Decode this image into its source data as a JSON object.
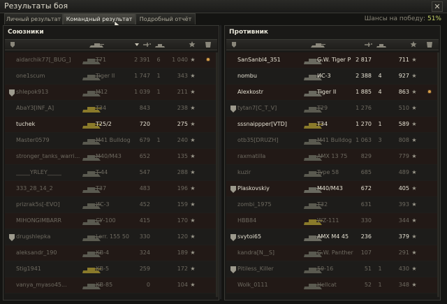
{
  "window": {
    "title": "Результаты боя",
    "close_label": "✕"
  },
  "tabs": [
    {
      "label": "Личный результат",
      "active": false
    },
    {
      "label": "Командный результат",
      "active": true
    },
    {
      "label": "Подробный отчёт",
      "active": false
    }
  ],
  "win_chance": {
    "label": "Шансы на победу:",
    "value": "51%"
  },
  "allies": {
    "title": "Союзники",
    "rows": [
      {
        "name": "aidarchik77[_BUG_]",
        "vehicle": "T71",
        "damage": "2 391",
        "kills": "6",
        "xp": "1 040",
        "status": "dead",
        "medal": true,
        "platoon": false,
        "tank_color": "#5a5a50"
      },
      {
        "name": "one1scum",
        "vehicle": "Tiger II",
        "damage": "1 747",
        "kills": "1",
        "xp": "343",
        "status": "dead",
        "medal": false,
        "platoon": false,
        "tank_color": "#5a5a50"
      },
      {
        "name": "shlepok913",
        "vehicle": "M12",
        "damage": "1 039",
        "kills": "1",
        "xp": "211",
        "status": "dead",
        "medal": false,
        "platoon": true,
        "tank_color": "#5a5a50"
      },
      {
        "name": "AbaY3[INF_A]",
        "vehicle": "T34",
        "damage": "843",
        "kills": "",
        "xp": "238",
        "status": "dead",
        "medal": false,
        "platoon": false,
        "tank_color": "#8a7a2a"
      },
      {
        "name": "tuchek",
        "vehicle": "T25/2",
        "damage": "720",
        "kills": "",
        "xp": "275",
        "status": "alive",
        "medal": false,
        "platoon": false,
        "tank_color": "#8a7a2a"
      },
      {
        "name": "Master0579",
        "vehicle": "M41 Bulldog",
        "damage": "679",
        "kills": "1",
        "xp": "240",
        "status": "dead",
        "medal": false,
        "platoon": false,
        "tank_color": "#5a5a50"
      },
      {
        "name": "stronger_tanks_warri...",
        "vehicle": "M40/M43",
        "damage": "652",
        "kills": "",
        "xp": "135",
        "status": "dead",
        "medal": false,
        "platoon": false,
        "tank_color": "#5a5a50"
      },
      {
        "name": "_____YRLEY_____",
        "vehicle": "T-44",
        "damage": "547",
        "kills": "",
        "xp": "288",
        "status": "dead",
        "medal": false,
        "platoon": false,
        "tank_color": "#5a5a50"
      },
      {
        "name": "333_28_14_2",
        "vehicle": "T37",
        "damage": "483",
        "kills": "",
        "xp": "196",
        "status": "dead",
        "medal": false,
        "platoon": false,
        "tank_color": "#5a5a50"
      },
      {
        "name": "prizrak5s[-EVO]",
        "vehicle": "ИС-3",
        "damage": "452",
        "kills": "",
        "xp": "159",
        "status": "dead",
        "medal": false,
        "platoon": false,
        "tank_color": "#5a5a50"
      },
      {
        "name": "MIHONGIMBARR",
        "vehicle": "СУ-100",
        "damage": "415",
        "kills": "",
        "xp": "170",
        "status": "dead",
        "medal": false,
        "platoon": false,
        "tank_color": "#5a5a50"
      },
      {
        "name": "drugshlepka",
        "vehicle": "Lorr. 155 50",
        "damage": "330",
        "kills": "",
        "xp": "120",
        "status": "dead",
        "medal": false,
        "platoon": true,
        "tank_color": "#5a5a50"
      },
      {
        "name": "aleksandr_190",
        "vehicle": "КВ-4",
        "damage": "324",
        "kills": "",
        "xp": "189",
        "status": "dead",
        "medal": false,
        "platoon": false,
        "tank_color": "#5a5a50"
      },
      {
        "name": "Stig1941",
        "vehicle": "КВ-5",
        "damage": "259",
        "kills": "",
        "xp": "172",
        "status": "dead",
        "medal": false,
        "platoon": false,
        "tank_color": "#8a7a2a"
      },
      {
        "name": "vanya_myaso45...",
        "vehicle": "КВ-85",
        "damage": "0",
        "kills": "",
        "xp": "104",
        "status": "dead",
        "medal": false,
        "platoon": false,
        "tank_color": "#5a5a50"
      }
    ]
  },
  "enemies": {
    "title": "Противник",
    "rows": [
      {
        "name": "SanSanbl4_351",
        "vehicle": "G.W. Tiger P",
        "damage": "2 817",
        "kills": "",
        "xp": "711",
        "status": "alive",
        "medal": false,
        "platoon": false,
        "tank_color": "#6a6a60"
      },
      {
        "name": "nombu",
        "vehicle": "ИС-3",
        "damage": "2 388",
        "kills": "4",
        "xp": "927",
        "status": "alive",
        "medal": false,
        "platoon": false,
        "tank_color": "#6a6a60"
      },
      {
        "name": "Alexkostr",
        "vehicle": "Tiger II",
        "damage": "1 885",
        "kills": "4",
        "xp": "863",
        "status": "alive",
        "medal": true,
        "platoon": false,
        "tank_color": "#6a6a60"
      },
      {
        "name": "tytan7[C_T_V]",
        "vehicle": "T29",
        "damage": "1 276",
        "kills": "",
        "xp": "510",
        "status": "dead",
        "medal": false,
        "platoon": true,
        "tank_color": "#5a5a50"
      },
      {
        "name": "sssnaippper[VTD]",
        "vehicle": "T34",
        "damage": "1 270",
        "kills": "1",
        "xp": "589",
        "status": "alive",
        "medal": false,
        "platoon": false,
        "tank_color": "#8a7a2a"
      },
      {
        "name": "otb35[DRUZH]",
        "vehicle": "M41 Bulldog",
        "damage": "1 063",
        "kills": "3",
        "xp": "808",
        "status": "dead",
        "medal": false,
        "platoon": false,
        "tank_color": "#5a5a50"
      },
      {
        "name": "raxmatilla",
        "vehicle": "AMX 13 75",
        "damage": "829",
        "kills": "",
        "xp": "779",
        "status": "dead",
        "medal": false,
        "platoon": false,
        "tank_color": "#5a5a50"
      },
      {
        "name": "kuzir",
        "vehicle": "Type 58",
        "damage": "685",
        "kills": "",
        "xp": "489",
        "status": "dead",
        "medal": false,
        "platoon": false,
        "tank_color": "#5a5a50"
      },
      {
        "name": "Plaskovskiy",
        "vehicle": "M40/M43",
        "damage": "672",
        "kills": "",
        "xp": "405",
        "status": "alive",
        "medal": false,
        "platoon": true,
        "tank_color": "#6a6a60"
      },
      {
        "name": "zombi_1975",
        "vehicle": "T32",
        "damage": "631",
        "kills": "",
        "xp": "393",
        "status": "dead",
        "medal": false,
        "platoon": false,
        "tank_color": "#5a5a50"
      },
      {
        "name": "HBB84",
        "vehicle": "WZ-111",
        "damage": "330",
        "kills": "",
        "xp": "344",
        "status": "dead",
        "medal": false,
        "platoon": false,
        "tank_color": "#8a7a2a"
      },
      {
        "name": "svytoi65",
        "vehicle": "AMX M4 45",
        "damage": "236",
        "kills": "",
        "xp": "379",
        "status": "alive",
        "medal": false,
        "platoon": true,
        "tank_color": "#6a6a60"
      },
      {
        "name": "kandra[N__S]",
        "vehicle": "G.W. Panther",
        "damage": "107",
        "kills": "",
        "xp": "291",
        "status": "dead",
        "medal": false,
        "platoon": false,
        "tank_color": "#5a5a50"
      },
      {
        "name": "Pitiless_Killer",
        "vehicle": "59-16",
        "damage": "51",
        "kills": "1",
        "xp": "430",
        "status": "dead",
        "medal": false,
        "platoon": true,
        "tank_color": "#5a5a50"
      },
      {
        "name": "Wolk_0111",
        "vehicle": "Hellcat",
        "damage": "52",
        "kills": "1",
        "xp": "348",
        "status": "dead",
        "medal": false,
        "platoon": false,
        "tank_color": "#5a5a50"
      }
    ]
  }
}
